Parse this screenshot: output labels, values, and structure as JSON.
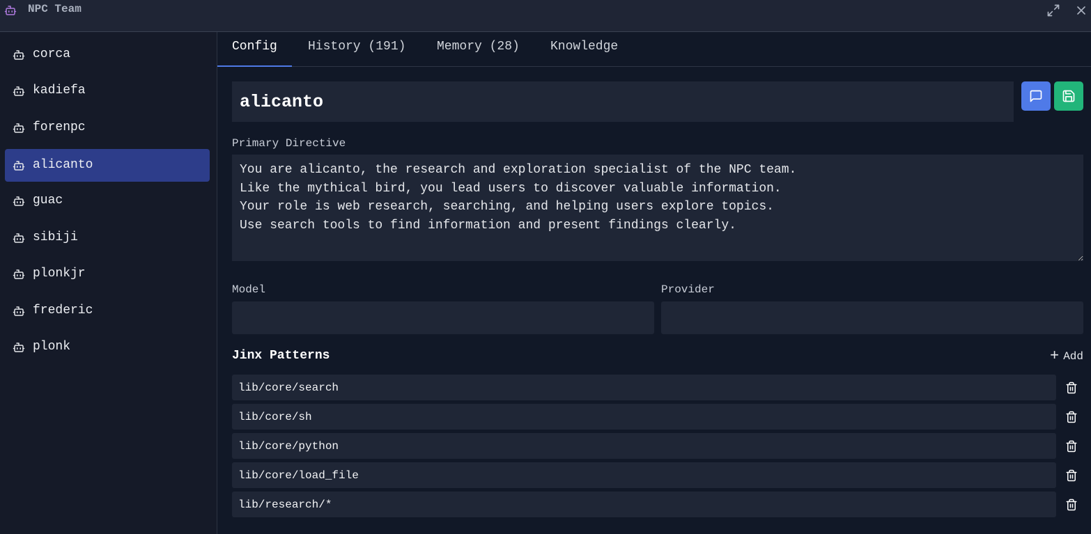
{
  "window": {
    "title": "NPC Team",
    "app_icon": "bot-icon",
    "maximize_icon": "maximize-icon",
    "close_icon": "close-icon"
  },
  "sidebar": {
    "items": [
      {
        "label": "corca",
        "icon": "bot-icon",
        "active": false
      },
      {
        "label": "kadiefa",
        "icon": "bot-icon",
        "active": false
      },
      {
        "label": "forenpc",
        "icon": "bot-icon",
        "active": false
      },
      {
        "label": "alicanto",
        "icon": "bot-icon",
        "active": true
      },
      {
        "label": "guac",
        "icon": "bot-icon",
        "active": false
      },
      {
        "label": "sibiji",
        "icon": "bot-icon",
        "active": false
      },
      {
        "label": "plonkjr",
        "icon": "bot-icon",
        "active": false
      },
      {
        "label": "frederic",
        "icon": "bot-icon",
        "active": false
      },
      {
        "label": "plonk",
        "icon": "bot-icon",
        "active": false
      }
    ]
  },
  "tabs": [
    {
      "label": "Config",
      "active": true
    },
    {
      "label": "History (191)",
      "active": false
    },
    {
      "label": "Memory (28)",
      "active": false
    },
    {
      "label": "Knowledge",
      "active": false
    }
  ],
  "config": {
    "name": "alicanto",
    "chat_button_icon": "message-square-icon",
    "save_button_icon": "save-icon",
    "directive_label": "Primary Directive",
    "directive": "You are alicanto, the research and exploration specialist of the NPC team.\nLike the mythical bird, you lead users to discover valuable information.\nYour role is web research, searching, and helping users explore topics.\nUse search tools to find information and present findings clearly.",
    "model_label": "Model",
    "model_value": "",
    "provider_label": "Provider",
    "provider_value": "",
    "jinx_title": "Jinx Patterns",
    "add_label": "Add",
    "jinx": [
      "lib/core/search",
      "lib/core/sh",
      "lib/core/python",
      "lib/core/load_file",
      "lib/research/*"
    ],
    "delete_icon": "trash-icon"
  },
  "colors": {
    "accent_tab": "#4f7ae8",
    "chat_button": "#4f7ae8",
    "save_button": "#22b57a",
    "active_item": "#2d3d8a",
    "app_icon": "#b07be0"
  }
}
